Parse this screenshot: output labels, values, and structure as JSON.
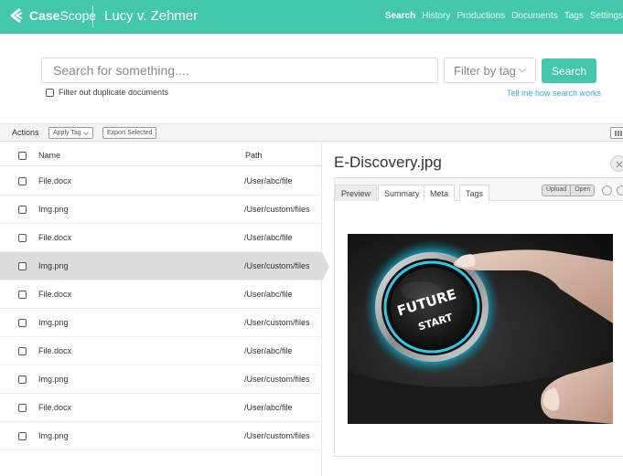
{
  "app": {
    "brand_bold": "Case",
    "brand_light": "Scope",
    "case_title": "Lucy v. Zehmer"
  },
  "nav": {
    "items": [
      "Search",
      "History",
      "Productions",
      "Documents",
      "Tags",
      "Settings"
    ],
    "active": "Search"
  },
  "search": {
    "placeholder": "Search for something....",
    "filter_placeholder": "Filter by tag",
    "button_label": "Search",
    "duplicate_label": "Filter out duplicate documents",
    "help_link": "Tell me how search works"
  },
  "actions": {
    "label": "Actions",
    "apply_tag": "Apply Tag",
    "export_selected": "Export Selected"
  },
  "table": {
    "headers": {
      "name": "Name",
      "path": "Path"
    },
    "rows": [
      {
        "name": "File.docx",
        "path": "/User/abc/file"
      },
      {
        "name": "Img.png",
        "path": "/User/custom/files"
      },
      {
        "name": "File.docx",
        "path": "/User/abc/file"
      },
      {
        "name": "Img.png",
        "path": "/User/custom/files"
      },
      {
        "name": "File.docx",
        "path": "/User/abc/file"
      },
      {
        "name": "Img.png",
        "path": "/User/custom/files"
      },
      {
        "name": "File.docx",
        "path": "/User/abc/file"
      },
      {
        "name": "Img.png",
        "path": "/User/custom/files"
      },
      {
        "name": "File.docx",
        "path": "/User/abc/file"
      },
      {
        "name": "Img.png",
        "path": "/User/custom/files"
      }
    ],
    "selected_row": 3
  },
  "preview": {
    "title": "E-Discovery.jpg",
    "tabs": [
      "Preview",
      "Summary",
      "Meta",
      "Tags"
    ],
    "active_tab": "Preview",
    "upload_label": "Upload",
    "open_label": "Open",
    "image_text_line1": "FUTURE",
    "image_text_line2": "START"
  },
  "colors": {
    "accent": "#43c8a9",
    "link": "#3fa9d8",
    "selected_row": "#dcdcdc"
  }
}
